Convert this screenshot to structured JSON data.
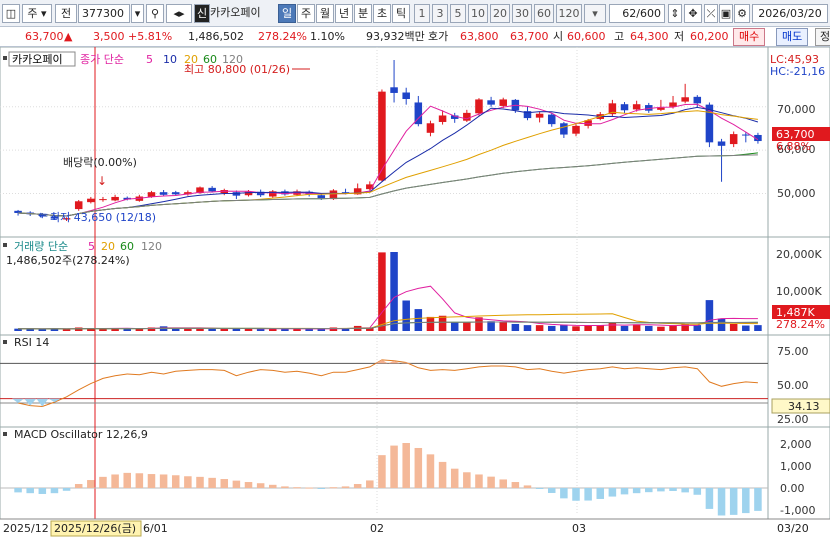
{
  "toolbar": {
    "market_code": "주",
    "prev_btn": "전",
    "stock_code": "377300",
    "sin_badge": "신",
    "stock_name": "카카오페이",
    "periods": [
      "일",
      "주",
      "월",
      "년",
      "분",
      "초",
      "틱"
    ],
    "intervals": [
      "1",
      "3",
      "5",
      "10",
      "20",
      "30",
      "60",
      "120"
    ],
    "count": "62/600",
    "date": "2026/03/20"
  },
  "info": {
    "price": "63,700",
    "change": "3,500",
    "change_pct": "+5.81%",
    "volume": "1,486,502",
    "volume_ratio": "278.24%",
    "turnover_pct": "1.10%",
    "amount": "93,932백만",
    "quote_label": "호가",
    "ask": "63,800",
    "bid": "63,700",
    "open_label": "시",
    "open": "60,600",
    "high_label": "고",
    "high": "64,300",
    "low_label": "저",
    "low": "60,200",
    "buy": "매수",
    "sell": "매도",
    "extra": "정"
  },
  "price_panel": {
    "name": "카카오페이",
    "ma_title": "종가 단순",
    "ma_periods": [
      "5",
      "10",
      "20",
      "60",
      "120"
    ],
    "ma_colors": [
      "#e020a0",
      "#1a2ca8",
      "#e0a000",
      "#1a8a1a",
      "#808080"
    ],
    "lc": "LC:45,93",
    "hc": "HC:-21,16",
    "high_annot": "최고 80,800 (01/26)",
    "low_annot": "최저 43,650 (12/18)",
    "div_annot": "배당락(0.00%)",
    "y_ticks": [
      "70,000",
      "60,000",
      "50,000"
    ],
    "cur_price": "63,700",
    "cur_pct": "6.88%"
  },
  "volume_panel": {
    "title": "거래량 단순",
    "ma_periods": [
      "5",
      "20",
      "60",
      "120"
    ],
    "ma_colors": [
      "#e020a0",
      "#e0a000",
      "#1a8a1a",
      "#808080"
    ],
    "value": "1,486,502주(278.24%)",
    "y_ticks": [
      "20,000K",
      "10,000K"
    ],
    "cur": "1,487K",
    "cur_pct": "278.24%"
  },
  "rsi_panel": {
    "title": "RSI 14",
    "y_ticks": [
      "75.00",
      "50.00",
      "25.00"
    ],
    "cur": "34.13"
  },
  "macd_panel": {
    "title": "MACD Oscillator 12,26,9",
    "y_ticks": [
      "2,000",
      "1,000",
      "0.00",
      "-1,000"
    ]
  },
  "xaxis": {
    "labels": [
      "2025/12",
      "2025/12/26(금)",
      "6/01",
      "02",
      "03",
      "03/20"
    ]
  },
  "colors": {
    "up": "#e0191e",
    "down": "#1f44c8",
    "rsi": "#e07a20"
  },
  "chart_data": {
    "type": "candlestick",
    "candles": [
      [
        46000,
        45500,
        46200,
        44900
      ],
      [
        45600,
        45200,
        45900,
        44800
      ],
      [
        45300,
        44800,
        45500,
        44300
      ],
      [
        44700,
        44200,
        44900,
        43900
      ],
      [
        44000,
        44300,
        44500,
        43650
      ],
      [
        46400,
        48200,
        48500,
        46000
      ],
      [
        48000,
        48800,
        49200,
        47700
      ],
      [
        48500,
        48700,
        49200,
        48100
      ],
      [
        48400,
        49200,
        49700,
        48200
      ],
      [
        49000,
        48600,
        49300,
        48400
      ],
      [
        48300,
        49300,
        49700,
        48100
      ],
      [
        49200,
        50300,
        50600,
        49000
      ],
      [
        50300,
        49700,
        50800,
        49300
      ],
      [
        50300,
        49800,
        50600,
        49600
      ],
      [
        49800,
        50300,
        50700,
        49500
      ],
      [
        50100,
        51400,
        51600,
        49900
      ],
      [
        51300,
        50500,
        51700,
        50200
      ],
      [
        50100,
        50800,
        51100,
        49600
      ],
      [
        50300,
        49500,
        50700,
        48700
      ],
      [
        49600,
        50400,
        50800,
        49300
      ],
      [
        50400,
        49600,
        50900,
        49200
      ],
      [
        49300,
        50500,
        50800,
        49000
      ],
      [
        50500,
        49800,
        50900,
        49500
      ],
      [
        49700,
        50500,
        50900,
        49400
      ],
      [
        50400,
        49800,
        50700,
        49300
      ],
      [
        49600,
        48900,
        50000,
        48500
      ],
      [
        48700,
        50700,
        51000,
        48500
      ],
      [
        50300,
        50000,
        51100,
        49800
      ],
      [
        49800,
        51200,
        52300,
        49700
      ],
      [
        51000,
        52100,
        52800,
        50700
      ],
      [
        53000,
        73500,
        74000,
        52800
      ],
      [
        74500,
        73200,
        80800,
        71000
      ],
      [
        73300,
        71800,
        74400,
        70500
      ],
      [
        71000,
        66000,
        72500,
        65500
      ],
      [
        64000,
        66200,
        66800,
        63200
      ],
      [
        66500,
        68000,
        69200,
        65900
      ],
      [
        68000,
        67200,
        68600,
        66300
      ],
      [
        66800,
        68600,
        69300,
        66500
      ],
      [
        68500,
        71700,
        72000,
        68000
      ],
      [
        71500,
        70500,
        72300,
        70000
      ],
      [
        70200,
        71700,
        72100,
        69700
      ],
      [
        71600,
        69200,
        71800,
        68600
      ],
      [
        69000,
        67400,
        70100,
        66900
      ],
      [
        67500,
        68400,
        68900,
        66400
      ],
      [
        68200,
        66000,
        68500,
        65400
      ],
      [
        66200,
        63600,
        66500,
        62800
      ],
      [
        63800,
        65600,
        66000,
        63200
      ],
      [
        65600,
        66900,
        67200,
        65000
      ],
      [
        67200,
        68300,
        68800,
        66900
      ],
      [
        68300,
        70800,
        71600,
        67900
      ],
      [
        70600,
        69200,
        71100,
        68500
      ],
      [
        69400,
        70600,
        71400,
        68900
      ],
      [
        70400,
        69100,
        70900,
        68600
      ],
      [
        69300,
        69800,
        71600,
        69000
      ],
      [
        70000,
        71000,
        72500,
        69600
      ],
      [
        71200,
        72200,
        75300,
        70800
      ],
      [
        72300,
        70800,
        72700,
        69800
      ],
      [
        70500,
        61800,
        71000,
        60700
      ],
      [
        62000,
        61000,
        62600,
        52700
      ],
      [
        61400,
        63700,
        64300,
        60700
      ],
      [
        63600,
        63500,
        64100,
        61800
      ],
      [
        63500,
        62100,
        64000,
        61500
      ]
    ],
    "volumes": [
      0.6,
      0.5,
      0.5,
      0.6,
      0.5,
      0.9,
      0.7,
      0.5,
      0.7,
      0.6,
      0.6,
      0.9,
      1.2,
      0.6,
      0.6,
      0.7,
      0.6,
      0.6,
      0.7,
      0.6,
      0.5,
      0.6,
      0.5,
      0.6,
      0.5,
      0.5,
      0.9,
      0.6,
      1.3,
      0.8,
      20.1,
      20.2,
      7.8,
      5.6,
      3.6,
      3.9,
      2.3,
      2.3,
      3.5,
      2.5,
      2.3,
      1.8,
      1.5,
      1.5,
      1.3,
      1.6,
      1.2,
      1.4,
      1.5,
      2.1,
      1.3,
      1.7,
      1.3,
      1.1,
      1.5,
      1.7,
      1.5,
      7.9,
      3.2,
      1.8,
      1.4,
      1.5
    ],
    "rsi": [
      25,
      22,
      21,
      26,
      32,
      40,
      47,
      53,
      56,
      58,
      57,
      60,
      58,
      61,
      62,
      63,
      63,
      62,
      56,
      60,
      63,
      62,
      60,
      61,
      59,
      56,
      60,
      60,
      63,
      66,
      74,
      73,
      71,
      65,
      62,
      63,
      62,
      64,
      66,
      67,
      67,
      66,
      63,
      64,
      61,
      59,
      61,
      63,
      64,
      66,
      64,
      65,
      64,
      63,
      65,
      66,
      64,
      49,
      44,
      47,
      49,
      48
    ],
    "macd": [
      -220,
      -260,
      -300,
      -260,
      -140,
      200,
      400,
      560,
      680,
      760,
      740,
      700,
      680,
      640,
      590,
      560,
      510,
      450,
      370,
      300,
      240,
      160,
      80,
      40,
      20,
      -20,
      40,
      80,
      200,
      380,
      1650,
      2130,
      2260,
      2010,
      1690,
      1310,
      970,
      790,
      680,
      570,
      430,
      300,
      130,
      -40,
      -250,
      -520,
      -640,
      -630,
      -550,
      -430,
      -320,
      -260,
      -210,
      -170,
      -150,
      -220,
      -340,
      -1050,
      -1380,
      -1350,
      -1260,
      -1150
    ]
  }
}
